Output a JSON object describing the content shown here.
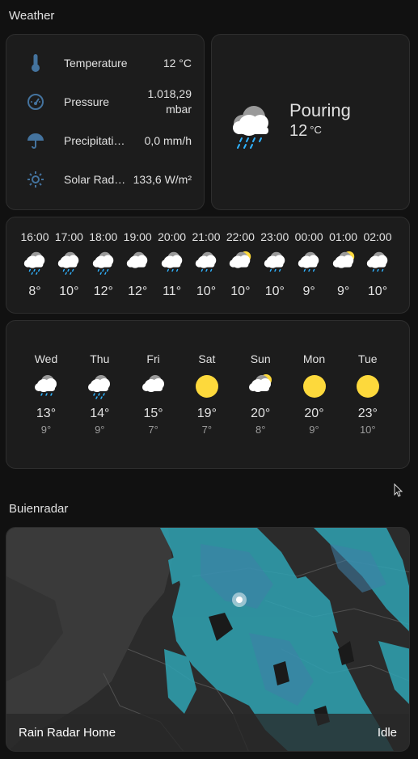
{
  "weather_section": {
    "title": "Weather"
  },
  "sensors": [
    {
      "icon": "thermometer-icon",
      "label": "Temperature",
      "value": "12 °C"
    },
    {
      "icon": "gauge-icon",
      "label": "Pressure",
      "value_line1": "1.018,29",
      "value_line2": "mbar"
    },
    {
      "icon": "umbrella-icon",
      "label": "Precipitatio…",
      "value": "0,0 mm/h"
    },
    {
      "icon": "sun-outline-icon",
      "label": "Solar Radi…",
      "value": "133,6 W/m²"
    }
  ],
  "current": {
    "condition": "Pouring",
    "temperature": "12",
    "unit": "°C",
    "icon": "pouring-icon"
  },
  "hourly": [
    {
      "time": "16:00",
      "icon": "pouring-icon",
      "temp": "8°"
    },
    {
      "time": "17:00",
      "icon": "pouring-icon",
      "temp": "10°"
    },
    {
      "time": "18:00",
      "icon": "pouring-icon",
      "temp": "12°"
    },
    {
      "time": "19:00",
      "icon": "cloudy-icon",
      "temp": "12°"
    },
    {
      "time": "20:00",
      "icon": "rainy-icon",
      "temp": "11°"
    },
    {
      "time": "21:00",
      "icon": "rainy-icon",
      "temp": "10°"
    },
    {
      "time": "22:00",
      "icon": "partly-cloudy-icon",
      "temp": "10°"
    },
    {
      "time": "23:00",
      "icon": "rainy-icon",
      "temp": "10°"
    },
    {
      "time": "00:00",
      "icon": "rainy-icon",
      "temp": "9°"
    },
    {
      "time": "01:00",
      "icon": "partly-cloudy-icon",
      "temp": "9°"
    },
    {
      "time": "02:00",
      "icon": "rainy-icon",
      "temp": "10°"
    }
  ],
  "daily": [
    {
      "day": "Wed",
      "icon": "rainy-icon",
      "high": "13°",
      "low": "9°"
    },
    {
      "day": "Thu",
      "icon": "pouring-icon",
      "high": "14°",
      "low": "9°"
    },
    {
      "day": "Fri",
      "icon": "cloudy-icon",
      "high": "15°",
      "low": "7°"
    },
    {
      "day": "Sat",
      "icon": "sunny-icon",
      "high": "19°",
      "low": "7°"
    },
    {
      "day": "Sun",
      "icon": "partly-cloudy-icon",
      "high": "20°",
      "low": "8°"
    },
    {
      "day": "Mon",
      "icon": "sunny-icon",
      "high": "20°",
      "low": "9°"
    },
    {
      "day": "Tue",
      "icon": "sunny-icon",
      "high": "23°",
      "low": "10°"
    }
  ],
  "radar_section": {
    "title": "Buienradar"
  },
  "radar": {
    "name": "Rain Radar Home",
    "state": "Idle"
  },
  "colors": {
    "background": "#111111",
    "card": "#1c1c1c",
    "icon_blue": "#44739e",
    "sun": "#fdd93c",
    "rain": "#30b3ff",
    "radar_rain": "#2fa3b3"
  }
}
